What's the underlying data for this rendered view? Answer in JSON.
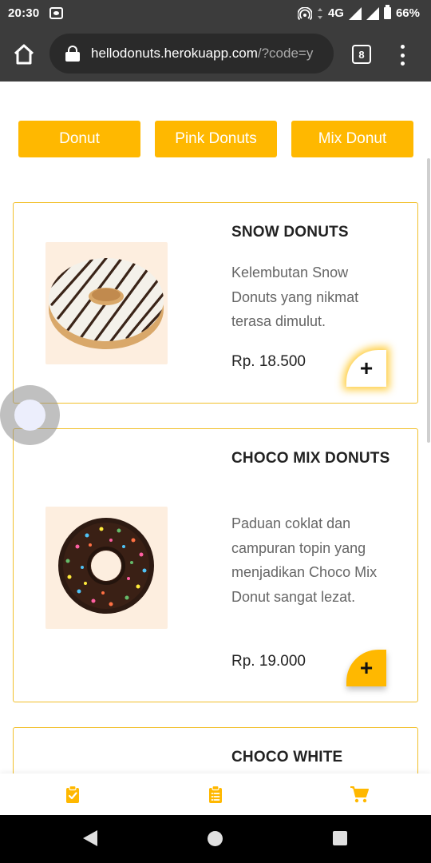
{
  "status_bar": {
    "time": "20:30",
    "network": "4G",
    "battery": "66%"
  },
  "browser": {
    "url_host": "hellodonuts.herokuapp.com",
    "url_rest": "/?code=y",
    "tab_count": "8"
  },
  "categories": [
    {
      "label": "Donut"
    },
    {
      "label": "Pink Donuts"
    },
    {
      "label": "Mix Donut"
    }
  ],
  "products": [
    {
      "name": "SNOW DONUTS",
      "description": "Kelembutan Snow Donuts yang nikmat terasa dimulut.",
      "price": "Rp. 18.500",
      "add_label": "+"
    },
    {
      "name": "CHOCO MIX DONUTS",
      "description": "Paduan coklat dan campuran topin yang menjadikan Choco Mix Donut sangat lezat.",
      "price": "Rp. 19.000",
      "add_label": "+"
    },
    {
      "name": "CHOCO WHITE"
    }
  ],
  "colors": {
    "accent": "#ffb800",
    "card_border": "#f2c02b",
    "thumb_bg": "#fdeedf",
    "toolbar": "#3c3c3c"
  },
  "bottom_nav": [
    {
      "icon": "clipboard-check-icon"
    },
    {
      "icon": "clipboard-list-icon"
    },
    {
      "icon": "cart-icon"
    }
  ]
}
